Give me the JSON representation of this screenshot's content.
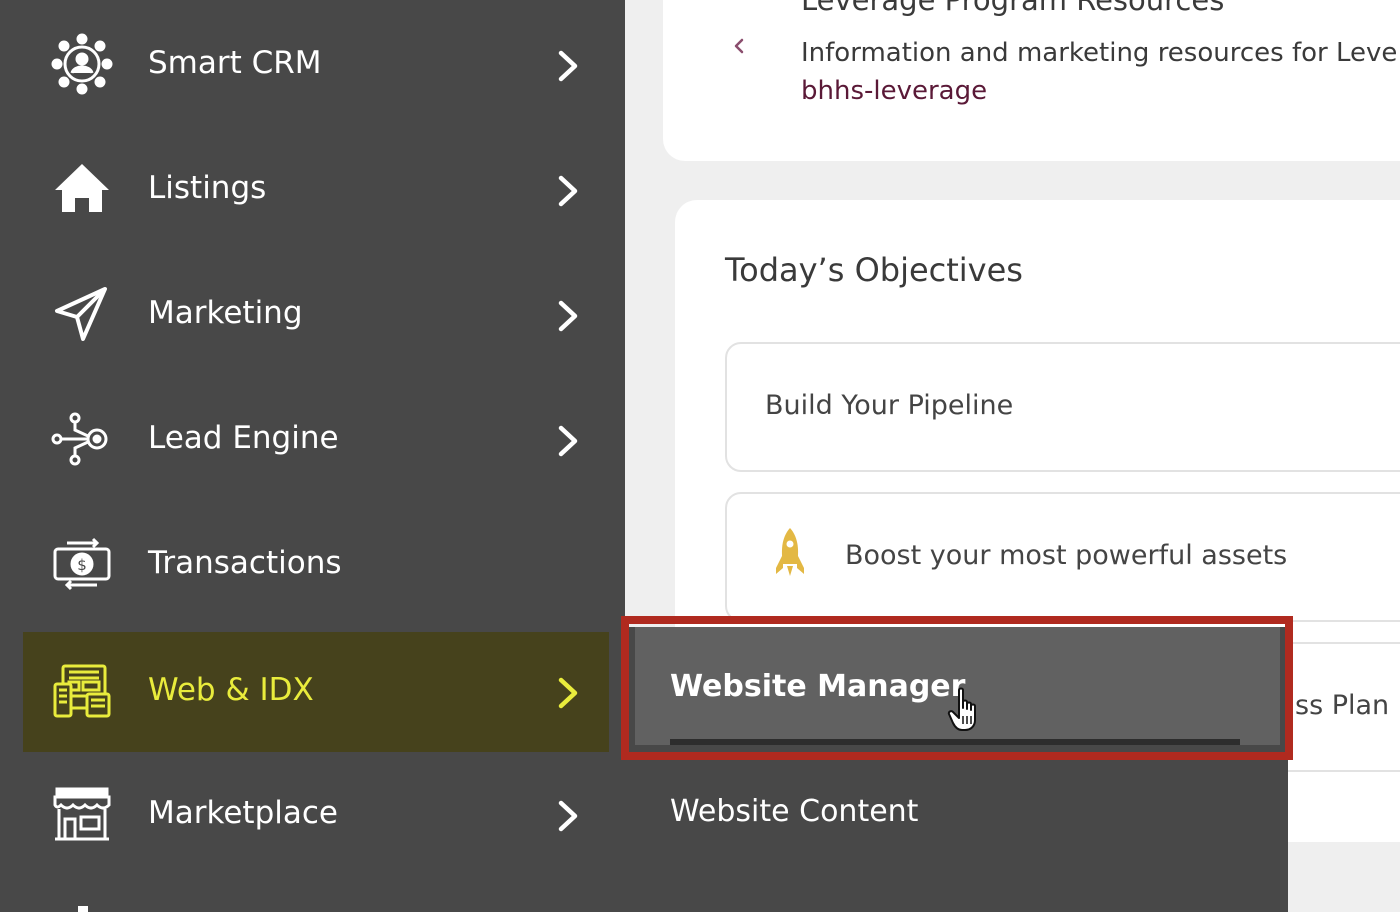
{
  "sidebar": {
    "items": [
      {
        "label": "Smart CRM",
        "icon": "crm-network-icon"
      },
      {
        "label": "Listings",
        "icon": "house-icon"
      },
      {
        "label": "Marketing",
        "icon": "paper-plane-icon"
      },
      {
        "label": "Lead Engine",
        "icon": "funnel-nodes-icon"
      },
      {
        "label": "Transactions",
        "icon": "money-exchange-icon"
      },
      {
        "label": "Web & IDX",
        "icon": "devices-icon",
        "active": true
      },
      {
        "label": "Marketplace",
        "icon": "storefront-icon"
      }
    ]
  },
  "resources_card": {
    "title": "Leverage Program Resources",
    "description": "Information and marketing resources for Leve",
    "link": "bhhs-leverage"
  },
  "objectives": {
    "title": "Today’s Objectives",
    "items": [
      {
        "label": "Build Your Pipeline"
      },
      {
        "label": "Boost your most powerful assets",
        "icon": "rocket-icon"
      },
      {
        "label": "ss Plan"
      }
    ]
  },
  "flyout": {
    "items": [
      {
        "label": "Website Manager",
        "hovered": true
      },
      {
        "label": "Website Content"
      }
    ]
  },
  "colors": {
    "sidebar_bg": "#484848",
    "active_bg": "#46421c",
    "active_text": "#e9ec3c",
    "highlight_border": "#b02a1f",
    "link": "#5a1937",
    "rocket": "#e3b844"
  }
}
